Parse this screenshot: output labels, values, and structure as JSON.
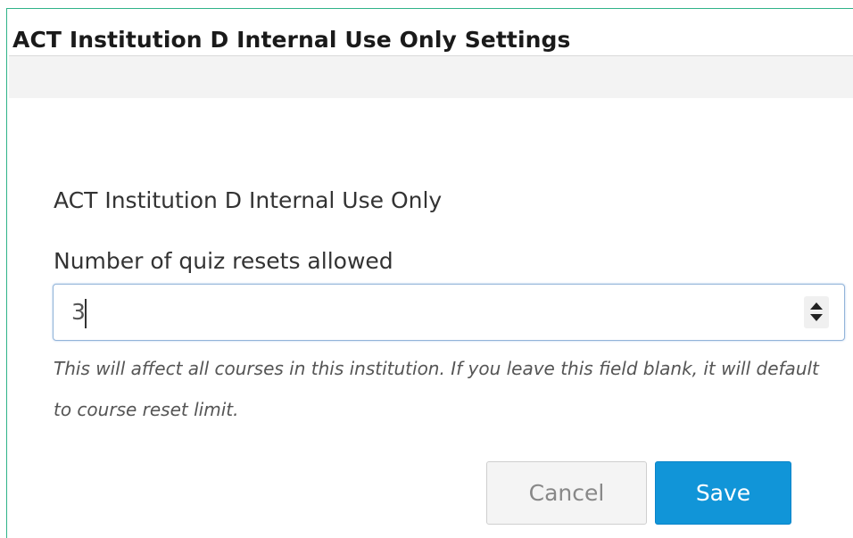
{
  "dialog": {
    "title": "ACT Institution D Internal Use Only Settings"
  },
  "form": {
    "section_heading": "ACT Institution D Internal Use Only",
    "field_label": "Number of quiz resets allowed",
    "field_value": "3",
    "help_text": "This will affect all courses in this institution. If you leave this field blank, it will default to course reset limit."
  },
  "buttons": {
    "cancel_label": "Cancel",
    "save_label": "Save"
  },
  "colors": {
    "accent_border": "#2fb389",
    "save_button": "#1195d8",
    "input_focus_border": "#93b4d9"
  },
  "icons": {
    "spinner": "number-spinner-icon"
  }
}
